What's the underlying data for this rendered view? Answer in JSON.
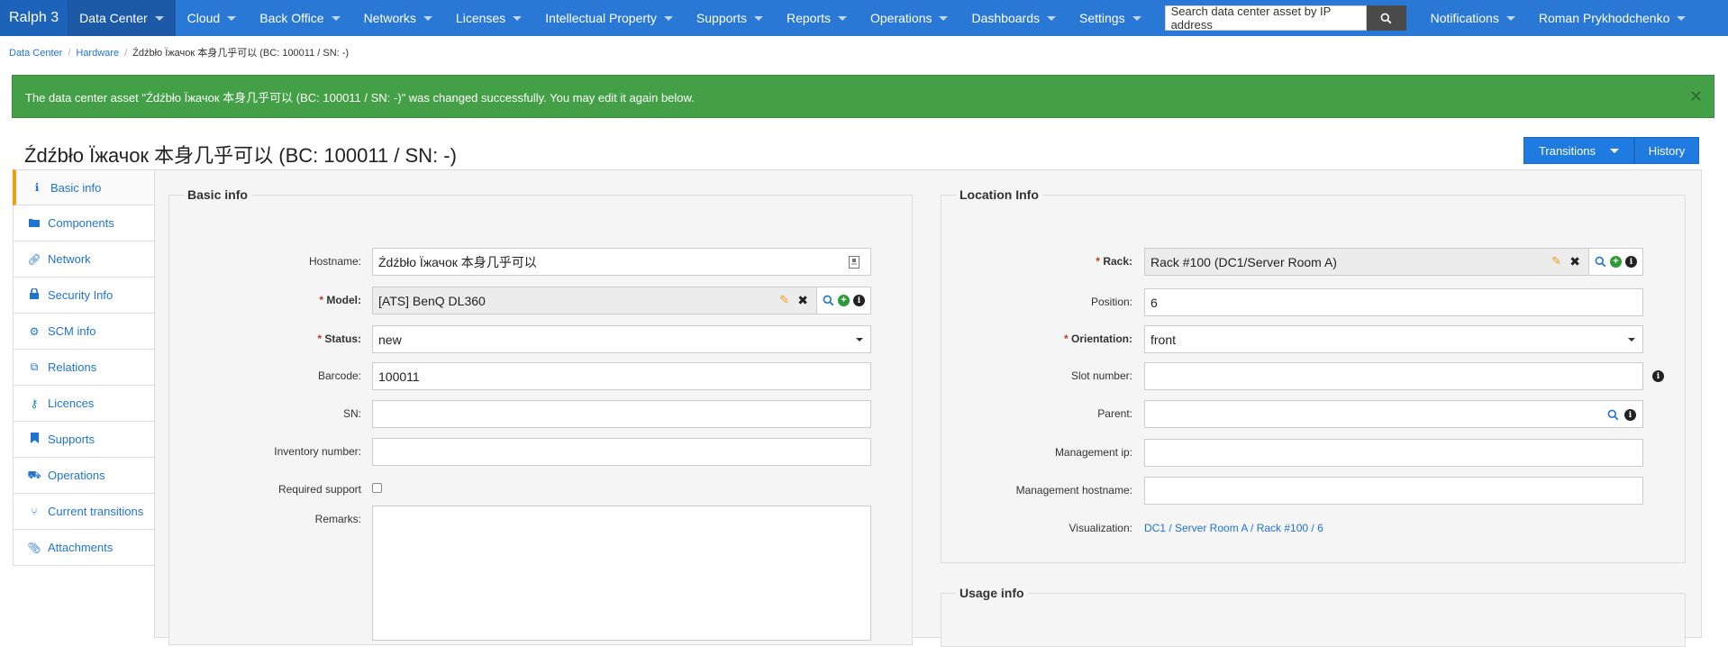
{
  "app": {
    "brand": "Ralph 3"
  },
  "nav": {
    "items": [
      {
        "label": "Data Center",
        "active": true
      },
      {
        "label": "Cloud"
      },
      {
        "label": "Back Office"
      },
      {
        "label": "Networks"
      },
      {
        "label": "Licenses"
      },
      {
        "label": "Intellectual Property"
      },
      {
        "label": "Supports"
      },
      {
        "label": "Reports"
      },
      {
        "label": "Operations"
      },
      {
        "label": "Dashboards"
      },
      {
        "label": "Settings"
      }
    ],
    "search_placeholder": "Search data center asset by IP address",
    "notifications": "Notifications",
    "user": "Roman Prykhodchenko"
  },
  "breadcrumb": {
    "items": [
      "Data Center",
      "Hardware"
    ],
    "current": "Źdźbło Їжачок 本身几乎可以 (BC: 100011 / SN: -)"
  },
  "alert": {
    "message": "The data center asset \"Źdźbło Їжачок 本身几乎可以 (BC: 100011 / SN: -)\" was changed successfully. You may edit it again below."
  },
  "page": {
    "title": "Źdźbło Їжачок 本身几乎可以 (BC: 100011 / SN: -)",
    "transitions_label": "Transitions",
    "history_label": "History"
  },
  "sidebar": {
    "items": [
      {
        "label": "Basic info",
        "icon": "info-icon"
      },
      {
        "label": "Components",
        "icon": "folder-icon"
      },
      {
        "label": "Network",
        "icon": "link-icon"
      },
      {
        "label": "Security Info",
        "icon": "lock-icon"
      },
      {
        "label": "SCM info",
        "icon": "gears-icon"
      },
      {
        "label": "Relations",
        "icon": "relations-icon"
      },
      {
        "label": "Licences",
        "icon": "key-icon"
      },
      {
        "label": "Supports",
        "icon": "bookmark-icon"
      },
      {
        "label": "Operations",
        "icon": "operations-icon"
      },
      {
        "label": "Current transitions",
        "icon": "branch-icon"
      },
      {
        "label": "Attachments",
        "icon": "paperclip-icon"
      }
    ]
  },
  "basic_info": {
    "legend": "Basic info",
    "hostname_label": "Hostname:",
    "hostname_value": "Źdźbło Їжачок 本身几乎可以",
    "model_label": "Model:",
    "model_value": "[ATS] BenQ DL360",
    "status_label": "Status:",
    "status_value": "new",
    "barcode_label": "Barcode:",
    "barcode_value": "100011",
    "sn_label": "SN:",
    "sn_value": "",
    "inventory_label": "Inventory number:",
    "inventory_value": "",
    "required_support_label": "Required support",
    "remarks_label": "Remarks:"
  },
  "location_info": {
    "legend": "Location Info",
    "rack_label": "Rack:",
    "rack_value": "Rack #100 (DC1/Server Room A)",
    "position_label": "Position:",
    "position_value": "6",
    "orientation_label": "Orientation:",
    "orientation_value": "front",
    "slot_label": "Slot number:",
    "slot_value": "",
    "parent_label": "Parent:",
    "parent_value": "",
    "mgmt_ip_label": "Management ip:",
    "mgmt_ip_value": "",
    "mgmt_host_label": "Management hostname:",
    "mgmt_host_value": "",
    "visualization_label": "Visualization:",
    "visualization_value": "DC1 / Server Room A / Rack #100 / 6"
  },
  "usage_info": {
    "legend": "Usage info"
  }
}
